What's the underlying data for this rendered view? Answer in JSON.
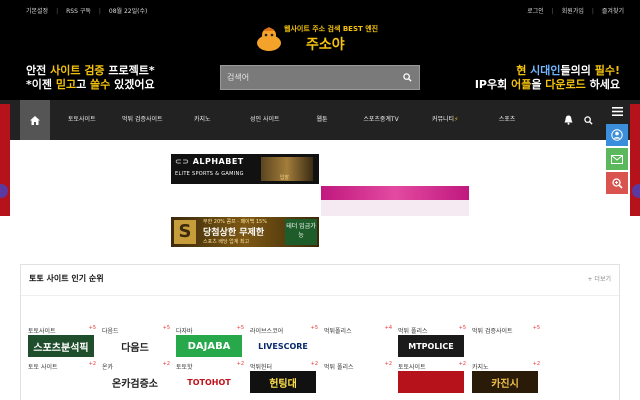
{
  "util_links": {
    "left": [
      "기본설정",
      "RSS 구독",
      "08월 22일(수)"
    ],
    "right": [
      "로그인",
      "회원가입",
      "즐겨찾기"
    ]
  },
  "logo": {
    "tagline": "웹사이트 주소 검색 BEST 엔진",
    "name": "주소야"
  },
  "promo_left": {
    "line1_a": "안전",
    "line1_b": "사이트",
    "line1_c": "검증",
    "line1_d": "프로젝트*",
    "line2_a": "*이젠",
    "line2_b": "믿고",
    "line2_c": "쓸수",
    "line2_d": "있겠어요"
  },
  "promo_right": {
    "line1_a": "현",
    "line1_b": "시대인",
    "line1_c": "들의",
    "line1_d": "필수!",
    "line2_a": "IP우회",
    "line2_b": "어플",
    "line2_c": "을",
    "line2_d": "다운로드",
    "line2_e": "하세요"
  },
  "search": {
    "placeholder": "검색어",
    "icon": "search-icon"
  },
  "nav": {
    "items": [
      "토토사이트",
      "먹튀 검증사이트",
      "카지노",
      "성인 사이트",
      "웹툰",
      "스포츠중계TV",
      "커뮤니티",
      "스포츠"
    ],
    "icons": [
      "bell-icon",
      "search-icon",
      "menu-icon"
    ]
  },
  "quick_menu": [
    "user-icon",
    "message-icon",
    "search-plus-icon"
  ],
  "banners": {
    "alphabet": {
      "title": "ALPHABET",
      "subtitle": "ELITE SPORTS & GAMING",
      "cta": "입장"
    },
    "gold": {
      "mark": "S",
      "line1": "무한 20% 콤프 · 페이백 15%",
      "line2": "당첨상한 무제한",
      "line3": "스포츠 배당 업계 최고",
      "tag": "테더 입금가능"
    }
  },
  "section": {
    "title": "토토 사이트 인기 순위",
    "more": "+ 더보기",
    "rows": [
      [
        {
          "name": "토토사이트",
          "badge": "+5",
          "logo": "스포츠분석픽",
          "bg": "#1f4e2c",
          "fg": "#ffffff"
        },
        {
          "name": "다음드",
          "badge": "+5",
          "logo": "다음드",
          "bg": "#ffffff",
          "fg": "#222222"
        },
        {
          "name": "다자바",
          "badge": "+5",
          "logo": "DAJABA",
          "bg": "#27a84a",
          "fg": "#ffffff"
        },
        {
          "name": "라이브스코어",
          "badge": "+5",
          "logo": "LIVESCORE",
          "bg": "#ffffff",
          "fg": "#0a2a6e"
        },
        {
          "name": "먹튀폴리스",
          "badge": "+4",
          "logo": "",
          "bg": "#ffffff",
          "fg": "#222222"
        },
        {
          "name": "먹튀 폴리스",
          "badge": "+5",
          "logo": "MTPOLICE",
          "bg": "#1a1a1a",
          "fg": "#ffffff"
        },
        {
          "name": "먹튀 검증사이트",
          "badge": "+5",
          "logo": "",
          "bg": "#ffffff",
          "fg": "#222222"
        }
      ],
      [
        {
          "name": "토토 사이트",
          "badge": "+2",
          "logo": "",
          "bg": "#ffffff",
          "fg": "#222222"
        },
        {
          "name": "온카",
          "badge": "+2",
          "logo": "온카검증소",
          "bg": "#ffffff",
          "fg": "#222222"
        },
        {
          "name": "토토핫",
          "badge": "+2",
          "logo": "TOTOHOT",
          "bg": "#ffffff",
          "fg": "#c0121a"
        },
        {
          "name": "먹튀헌터",
          "badge": "+2",
          "logo": "헌팅대",
          "bg": "#111111",
          "fg": "#ffe14a"
        },
        {
          "name": "먹튀 폴리스",
          "badge": "+2",
          "logo": "",
          "bg": "#ffffff",
          "fg": "#222222"
        },
        {
          "name": "토토사이트",
          "badge": "+2",
          "logo": "",
          "bg": "#b5121b",
          "fg": "#ffffff"
        },
        {
          "name": "카지노",
          "badge": "+2",
          "logo": "카진시",
          "bg": "#2a1a08",
          "fg": "#f1c24a"
        }
      ]
    ]
  },
  "colors": {
    "top_bg": "#000000",
    "nav_bg": "#222222",
    "accent_yellow": "#f4c20d",
    "quick_user": "#3b8edb",
    "quick_message": "#5cb85c",
    "quick_search": "#d9534f"
  }
}
